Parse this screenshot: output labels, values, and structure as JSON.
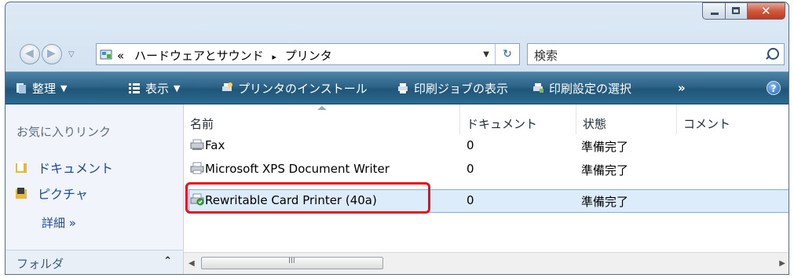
{
  "window": {
    "caption_buttons": [
      "minimize",
      "maximize",
      "close"
    ]
  },
  "address": {
    "chevron": "«",
    "path": [
      "ハードウェアとサウンド",
      "プリンタ"
    ],
    "separator": "▸",
    "search_placeholder": "検索"
  },
  "toolbar": {
    "organize": "整理",
    "views": "表示",
    "add_printer": "プリンタのインストール",
    "see_print_jobs": "印刷ジョブの表示",
    "select_prefs": "印刷設定の選択",
    "overflow": "»",
    "help": "?"
  },
  "nav": {
    "favorites_header": "お気に入りリンク",
    "links": [
      "ドキュメント",
      "ピクチャ"
    ],
    "more": "詳細 »",
    "folders": "フォルダ"
  },
  "list": {
    "columns": [
      "名前",
      "ドキュメント",
      "状態",
      "コメント"
    ],
    "rows": [
      {
        "name": "Fax",
        "docs": "0",
        "status": "準備完了",
        "icon": "fax-icon"
      },
      {
        "name": "Microsoft XPS Document Writer",
        "docs": "0",
        "status": "準備完了",
        "icon": "printer-icon"
      },
      {
        "name": "Rewritable Card Printer (40a)",
        "docs": "0",
        "status": "準備完了",
        "icon": "default-printer-icon",
        "selected": true
      }
    ],
    "scroll_thumb_grip": "III"
  },
  "colors": {
    "toolbar": "#2c6387",
    "selection": "#ddecfb",
    "highlight_box": "#e8101c",
    "link": "#1a4da0"
  }
}
